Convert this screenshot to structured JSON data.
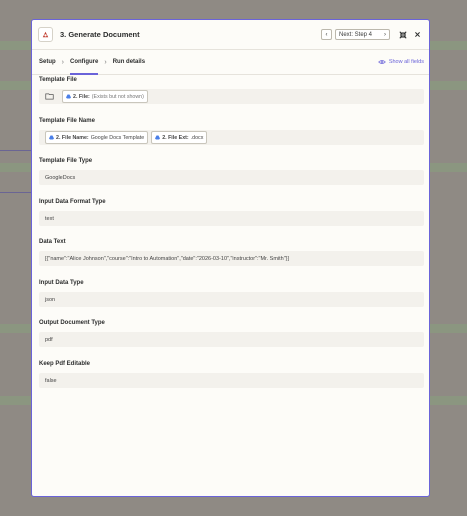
{
  "header": {
    "title": "3. Generate Document",
    "next_label": "Next: Step 4"
  },
  "tabs": [
    {
      "label": "Setup"
    },
    {
      "label": "Configure"
    },
    {
      "label": "Run details"
    }
  ],
  "show_all_fields": "Show all fields",
  "fields": {
    "template_file": {
      "label": "Template File",
      "pill_name": "2. File:",
      "pill_value": "(Exists but not shown)"
    },
    "template_file_name": {
      "label": "Template File Name",
      "pill1_name": "2. File Name:",
      "pill1_value": "Google Docs Template",
      "pill2_name": "2. File Ext:",
      "pill2_value": ".docx"
    },
    "template_file_type": {
      "label": "Template File Type",
      "value": "GoogleDocs"
    },
    "input_data_format_type": {
      "label": "Input Data Format Type",
      "value": "text"
    },
    "data_text": {
      "label": "Data Text",
      "value": "[{\"name\":\"Alice Johnson\",\"course\":\"Intro to Automation\",\"date\":\"2026-03-10\",\"instructor\":\"Mr. Smith\"}]"
    },
    "input_data_type": {
      "label": "Input Data Type",
      "value": "json"
    },
    "output_document_type": {
      "label": "Output Document Type",
      "value": "pdf"
    },
    "keep_pdf_editable": {
      "label": "Keep Pdf Editable",
      "value": "false"
    }
  },
  "colors": {
    "accent": "#6a63d9",
    "overlay": "#8f8a84"
  }
}
